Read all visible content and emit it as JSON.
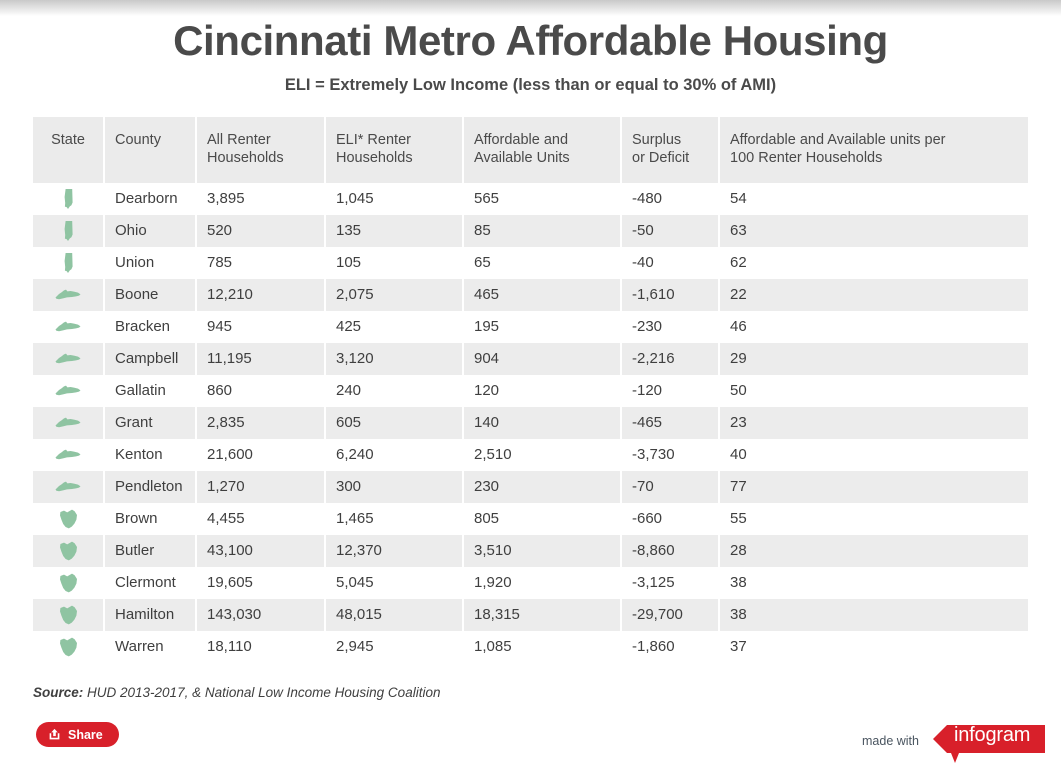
{
  "header": {
    "title": "Cincinnati Metro Affordable Housing",
    "subtitle": "ELI = Extremely Low Income (less than or equal to 30% of AMI)"
  },
  "table": {
    "columns": [
      "State",
      "County",
      "All Renter Households",
      "ELI* Renter Households",
      "Affordable and Available Units",
      "Surplus or Deficit",
      "Affordable and Available units per 100 Renter Households"
    ],
    "column_lines": [
      [
        "State"
      ],
      [
        "County"
      ],
      [
        "All Renter",
        "Households"
      ],
      [
        "ELI* Renter",
        "Households"
      ],
      [
        "Affordable and",
        "Available Units"
      ],
      [
        "Surplus",
        "or Deficit"
      ],
      [
        "Affordable and Available units per",
        "100 Renter Households"
      ]
    ],
    "rows": [
      {
        "state": "indiana",
        "county": "Dearborn",
        "all_renter": "3,895",
        "eli_renter": "1,045",
        "available_units": "565",
        "surplus_deficit": "-480",
        "per_100": "54"
      },
      {
        "state": "indiana",
        "county": "Ohio",
        "all_renter": "520",
        "eli_renter": "135",
        "available_units": "85",
        "surplus_deficit": "-50",
        "per_100": "63"
      },
      {
        "state": "indiana",
        "county": "Union",
        "all_renter": "785",
        "eli_renter": "105",
        "available_units": "65",
        "surplus_deficit": "-40",
        "per_100": "62"
      },
      {
        "state": "kentucky",
        "county": "Boone",
        "all_renter": "12,210",
        "eli_renter": "2,075",
        "available_units": "465",
        "surplus_deficit": "-1,610",
        "per_100": "22"
      },
      {
        "state": "kentucky",
        "county": "Bracken",
        "all_renter": "945",
        "eli_renter": "425",
        "available_units": "195",
        "surplus_deficit": "-230",
        "per_100": "46"
      },
      {
        "state": "kentucky",
        "county": "Campbell",
        "all_renter": "11,195",
        "eli_renter": "3,120",
        "available_units": "904",
        "surplus_deficit": "-2,216",
        "per_100": "29"
      },
      {
        "state": "kentucky",
        "county": "Gallatin",
        "all_renter": "860",
        "eli_renter": "240",
        "available_units": "120",
        "surplus_deficit": "-120",
        "per_100": "50"
      },
      {
        "state": "kentucky",
        "county": "Grant",
        "all_renter": "2,835",
        "eli_renter": "605",
        "available_units": "140",
        "surplus_deficit": "-465",
        "per_100": "23"
      },
      {
        "state": "kentucky",
        "county": "Kenton",
        "all_renter": "21,600",
        "eli_renter": "6,240",
        "available_units": "2,510",
        "surplus_deficit": "-3,730",
        "per_100": "40"
      },
      {
        "state": "kentucky",
        "county": "Pendleton",
        "all_renter": "1,270",
        "eli_renter": "300",
        "available_units": "230",
        "surplus_deficit": "-70",
        "per_100": "77"
      },
      {
        "state": "ohio",
        "county": "Brown",
        "all_renter": "4,455",
        "eli_renter": "1,465",
        "available_units": "805",
        "surplus_deficit": "-660",
        "per_100": "55"
      },
      {
        "state": "ohio",
        "county": "Butler",
        "all_renter": "43,100",
        "eli_renter": "12,370",
        "available_units": "3,510",
        "surplus_deficit": "-8,860",
        "per_100": "28"
      },
      {
        "state": "ohio",
        "county": "Clermont",
        "all_renter": "19,605",
        "eli_renter": "5,045",
        "available_units": "1,920",
        "surplus_deficit": "-3,125",
        "per_100": "38"
      },
      {
        "state": "ohio",
        "county": "Hamilton",
        "all_renter": "143,030",
        "eli_renter": "48,015",
        "available_units": "18,315",
        "surplus_deficit": "-29,700",
        "per_100": "38"
      },
      {
        "state": "ohio",
        "county": "Warren",
        "all_renter": "18,110",
        "eli_renter": "2,945",
        "available_units": "1,085",
        "surplus_deficit": "-1,860",
        "per_100": "37"
      }
    ]
  },
  "source": {
    "label": "Source:",
    "text": " HUD 2013-2017, & National Low Income Housing Coalition"
  },
  "footer": {
    "share_label": "Share",
    "share_icon": "share-export-icon",
    "made_with_label": "made with",
    "brand": "infogram"
  },
  "colors": {
    "brand_red": "#d8202a",
    "state_icon_green": "#8fc4a2",
    "header_bg": "#ebebeb",
    "row_alt_bg": "#ececec",
    "text": "#3f3f3f"
  },
  "chart_data": {
    "type": "table",
    "title": "Cincinnati Metro Affordable Housing",
    "subtitle": "ELI = Extremely Low Income (less than or equal to 30% of AMI)",
    "columns": [
      "State",
      "County",
      "All Renter Households",
      "ELI* Renter Households",
      "Affordable and Available Units",
      "Surplus or Deficit",
      "Affordable and Available units per 100 Renter Households"
    ],
    "rows": [
      [
        "Indiana",
        "Dearborn",
        3895,
        1045,
        565,
        -480,
        54
      ],
      [
        "Indiana",
        "Ohio",
        520,
        135,
        85,
        -50,
        63
      ],
      [
        "Indiana",
        "Union",
        785,
        105,
        65,
        -40,
        62
      ],
      [
        "Kentucky",
        "Boone",
        12210,
        2075,
        465,
        -1610,
        22
      ],
      [
        "Kentucky",
        "Bracken",
        945,
        425,
        195,
        -230,
        46
      ],
      [
        "Kentucky",
        "Campbell",
        11195,
        3120,
        904,
        -2216,
        29
      ],
      [
        "Kentucky",
        "Gallatin",
        860,
        240,
        120,
        -120,
        50
      ],
      [
        "Kentucky",
        "Grant",
        2835,
        605,
        140,
        -465,
        23
      ],
      [
        "Kentucky",
        "Kenton",
        21600,
        6240,
        2510,
        -3730,
        40
      ],
      [
        "Kentucky",
        "Pendleton",
        1270,
        300,
        230,
        -70,
        77
      ],
      [
        "Ohio",
        "Brown",
        4455,
        1465,
        805,
        -660,
        55
      ],
      [
        "Ohio",
        "Butler",
        43100,
        12370,
        3510,
        -8860,
        28
      ],
      [
        "Ohio",
        "Clermont",
        19605,
        5045,
        1920,
        -3125,
        38
      ],
      [
        "Ohio",
        "Hamilton",
        143030,
        48015,
        18315,
        -29700,
        38
      ],
      [
        "Ohio",
        "Warren",
        18110,
        2945,
        1085,
        -1860,
        37
      ]
    ],
    "annotation": "Source: HUD 2013-2017, & National Low Income Housing Coalition"
  }
}
